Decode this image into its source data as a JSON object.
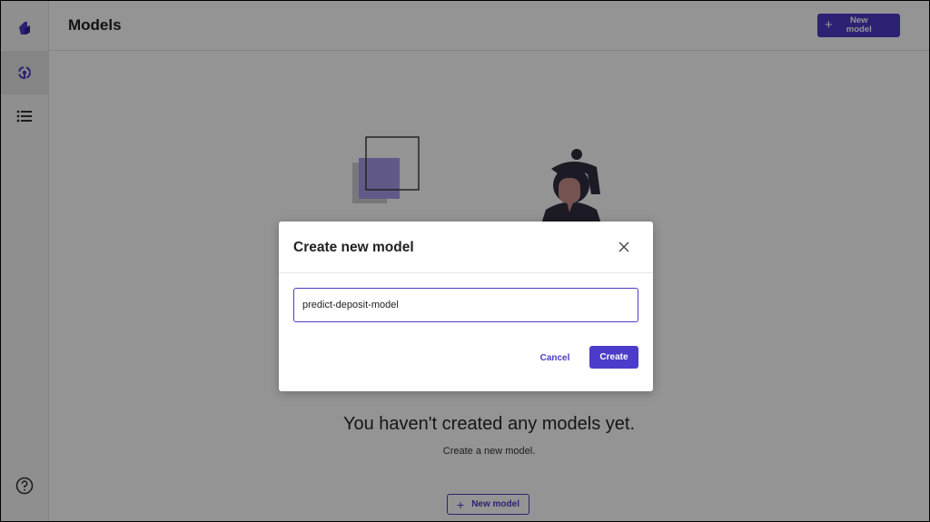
{
  "header": {
    "title": "Models",
    "new_model_button": "New model"
  },
  "sidebar": {
    "items": [
      {
        "icon": "logo-icon"
      },
      {
        "icon": "models-icon",
        "active": true
      },
      {
        "icon": "list-icon"
      },
      {
        "icon": "help-icon"
      }
    ]
  },
  "empty_state": {
    "title": "You haven't created any models yet.",
    "subtitle": "Create a new model.",
    "button": "New model"
  },
  "modal": {
    "title": "Create new model",
    "input_value": "predict-deposit-model",
    "cancel": "Cancel",
    "create": "Create"
  },
  "colors": {
    "accent": "#4b3cc9",
    "overlay": "rgba(0,0,0,0.42)"
  }
}
